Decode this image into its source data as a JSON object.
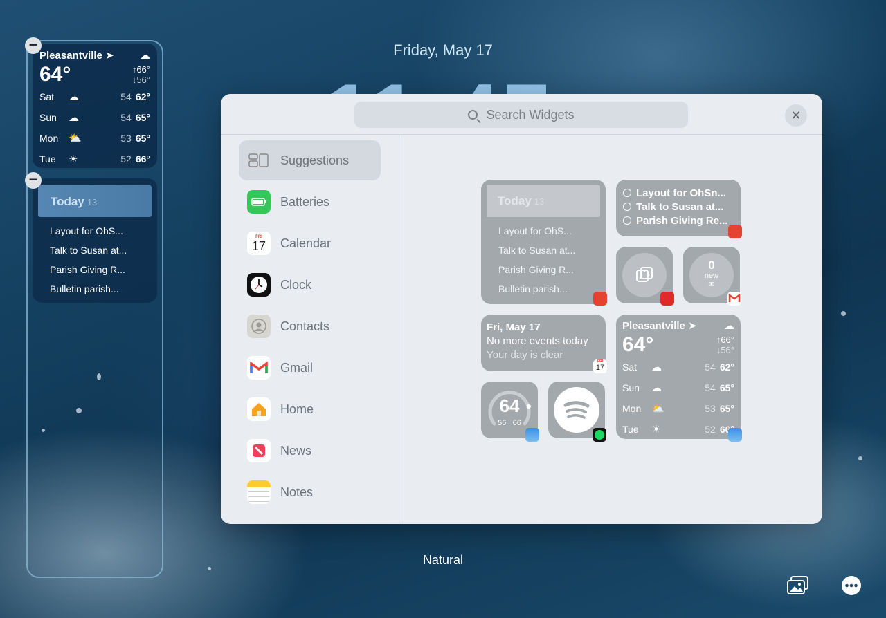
{
  "lock": {
    "date": "Friday, May 17"
  },
  "left_weather": {
    "city": "Pleasantville",
    "temp": "64°",
    "high": "↑66°",
    "low": "↓56°",
    "days": [
      {
        "day": "Sat",
        "lo": "54",
        "hi": "62°"
      },
      {
        "day": "Sun",
        "lo": "54",
        "hi": "65°"
      },
      {
        "day": "Mon",
        "lo": "53",
        "hi": "65°"
      },
      {
        "day": "Tue",
        "lo": "52",
        "hi": "66°"
      }
    ]
  },
  "left_reminders": {
    "title": "Today",
    "count": "13",
    "items": [
      "Layout for OhS...",
      "Talk to Susan at...",
      "Parish Giving R...",
      "Bulletin parish..."
    ]
  },
  "panel": {
    "search_placeholder": "Search Widgets",
    "sidebar": [
      {
        "label": "Suggestions"
      },
      {
        "label": "Batteries"
      },
      {
        "label": "Calendar",
        "cal_day": "FRI",
        "cal_num": "17"
      },
      {
        "label": "Clock"
      },
      {
        "label": "Contacts"
      },
      {
        "label": "Gmail"
      },
      {
        "label": "Home"
      },
      {
        "label": "News"
      },
      {
        "label": "Notes"
      }
    ],
    "reminders_widget": {
      "title": "Today",
      "count": "13",
      "items": [
        "Layout for OhS...",
        "Talk to Susan at...",
        "Parish Giving R...",
        "Bulletin parish..."
      ]
    },
    "todo_widget": {
      "items": [
        "Layout for OhSn...",
        "Talk to Susan at...",
        "Parish Giving Re..."
      ]
    },
    "gmail_widget": {
      "count": "0",
      "label": "new"
    },
    "calendar_widget": {
      "line1": "Fri, May 17",
      "line2": "No more events today",
      "line3": "Your day is clear",
      "badge_day": "FRI",
      "badge_num": "17"
    },
    "gauge_widget": {
      "temp": "64",
      "lo": "56",
      "hi": "66"
    },
    "weather_widget": {
      "city": "Pleasantville",
      "temp": "64°",
      "high": "↑66°",
      "low": "↓56°",
      "days": [
        {
          "day": "Sat",
          "lo": "54",
          "hi": "62°"
        },
        {
          "day": "Sun",
          "lo": "54",
          "hi": "65°"
        },
        {
          "day": "Mon",
          "lo": "53",
          "hi": "65°"
        },
        {
          "day": "Tue",
          "lo": "52",
          "hi": "66°"
        }
      ]
    }
  },
  "bottom": {
    "label": "Natural"
  }
}
